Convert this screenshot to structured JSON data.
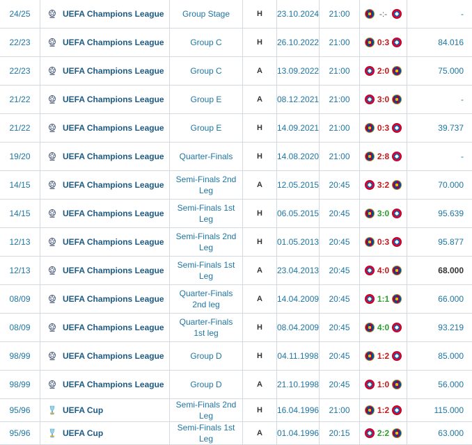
{
  "matches": [
    {
      "season": "24/25",
      "competition": "UEFA Champions League",
      "comp_icon": "ucl-icon",
      "round": "Group Stage",
      "venue": "H",
      "date": "23.10.2024",
      "time": "21:00",
      "home": "fcb",
      "away": "bay",
      "score": "-:-",
      "score_color": "grey",
      "attendance": "-",
      "att_bold": false
    },
    {
      "season": "22/23",
      "competition": "UEFA Champions League",
      "comp_icon": "ucl-icon",
      "round": "Group C",
      "venue": "H",
      "date": "26.10.2022",
      "time": "21:00",
      "home": "fcb",
      "away": "bay",
      "score": "0:3",
      "score_color": "red",
      "attendance": "84.016",
      "att_bold": false
    },
    {
      "season": "22/23",
      "competition": "UEFA Champions League",
      "comp_icon": "ucl-icon",
      "round": "Group C",
      "venue": "A",
      "date": "13.09.2022",
      "time": "21:00",
      "home": "bay",
      "away": "fcb",
      "score": "2:0",
      "score_color": "red",
      "attendance": "75.000",
      "att_bold": false
    },
    {
      "season": "21/22",
      "competition": "UEFA Champions League",
      "comp_icon": "ucl-icon",
      "round": "Group E",
      "venue": "A",
      "date": "08.12.2021",
      "time": "21:00",
      "home": "bay",
      "away": "fcb",
      "score": "3:0",
      "score_color": "red",
      "attendance": "-",
      "att_bold": false
    },
    {
      "season": "21/22",
      "competition": "UEFA Champions League",
      "comp_icon": "ucl-icon",
      "round": "Group E",
      "venue": "H",
      "date": "14.09.2021",
      "time": "21:00",
      "home": "fcb",
      "away": "bay",
      "score": "0:3",
      "score_color": "red",
      "attendance": "39.737",
      "att_bold": false
    },
    {
      "season": "19/20",
      "competition": "UEFA Champions League",
      "comp_icon": "ucl-icon",
      "round": "Quarter-Finals",
      "venue": "H",
      "date": "14.08.2020",
      "time": "21:00",
      "home": "fcb",
      "away": "bay",
      "score": "2:8",
      "score_color": "red",
      "attendance": "-",
      "att_bold": false
    },
    {
      "season": "14/15",
      "competition": "UEFA Champions League",
      "comp_icon": "ucl-icon",
      "round": "Semi-Finals 2nd Leg",
      "venue": "A",
      "date": "12.05.2015",
      "time": "20:45",
      "home": "bay",
      "away": "fcb",
      "score": "3:2",
      "score_color": "red",
      "attendance": "70.000",
      "att_bold": false
    },
    {
      "season": "14/15",
      "competition": "UEFA Champions League",
      "comp_icon": "ucl-icon",
      "round": "Semi-Finals 1st Leg",
      "venue": "H",
      "date": "06.05.2015",
      "time": "20:45",
      "home": "fcb",
      "away": "bay",
      "score": "3:0",
      "score_color": "green",
      "attendance": "95.639",
      "att_bold": false
    },
    {
      "season": "12/13",
      "competition": "UEFA Champions League",
      "comp_icon": "ucl-icon",
      "round": "Semi-Finals 2nd Leg",
      "venue": "H",
      "date": "01.05.2013",
      "time": "20:45",
      "home": "fcb",
      "away": "bay",
      "score": "0:3",
      "score_color": "red",
      "attendance": "95.877",
      "att_bold": false
    },
    {
      "season": "12/13",
      "competition": "UEFA Champions League",
      "comp_icon": "ucl-icon",
      "round": "Semi-Finals 1st Leg",
      "venue": "A",
      "date": "23.04.2013",
      "time": "20:45",
      "home": "bay",
      "away": "fcb",
      "score": "4:0",
      "score_color": "red",
      "attendance": "68.000",
      "att_bold": true
    },
    {
      "season": "08/09",
      "competition": "UEFA Champions League",
      "comp_icon": "ucl-icon",
      "round": "Quarter-Finals 2nd leg",
      "venue": "A",
      "date": "14.04.2009",
      "time": "20:45",
      "home": "bay",
      "away": "fcb",
      "score": "1:1",
      "score_color": "green",
      "attendance": "66.000",
      "att_bold": false
    },
    {
      "season": "08/09",
      "competition": "UEFA Champions League",
      "comp_icon": "ucl-icon",
      "round": "Quarter-Finals 1st leg",
      "venue": "H",
      "date": "08.04.2009",
      "time": "20:45",
      "home": "fcb",
      "away": "bay",
      "score": "4:0",
      "score_color": "green",
      "attendance": "93.219",
      "att_bold": false
    },
    {
      "season": "98/99",
      "competition": "UEFA Champions League",
      "comp_icon": "ucl-icon",
      "round": "Group D",
      "venue": "H",
      "date": "04.11.1998",
      "time": "20:45",
      "home": "fcb",
      "away": "bay",
      "score": "1:2",
      "score_color": "red",
      "attendance": "85.000",
      "att_bold": false
    },
    {
      "season": "98/99",
      "competition": "UEFA Champions League",
      "comp_icon": "ucl-icon",
      "round": "Group D",
      "venue": "A",
      "date": "21.10.1998",
      "time": "20:45",
      "home": "bay",
      "away": "fcb",
      "score": "1:0",
      "score_color": "red",
      "attendance": "56.000",
      "att_bold": false
    },
    {
      "season": "95/96",
      "competition": "UEFA Cup",
      "comp_icon": "uefa-cup-icon",
      "round": "Semi-Finals 2nd Leg",
      "venue": "H",
      "date": "16.04.1996",
      "time": "21:00",
      "home": "fcb",
      "away": "bay",
      "score": "1:2",
      "score_color": "red",
      "attendance": "115.000",
      "att_bold": false
    },
    {
      "season": "95/96",
      "competition": "UEFA Cup",
      "comp_icon": "uefa-cup-icon",
      "round": "Semi-Finals 1st Leg",
      "venue": "A",
      "date": "01.04.1996",
      "time": "20:15",
      "home": "bay",
      "away": "fcb",
      "score": "2:2",
      "score_color": "green",
      "attendance": "63.000",
      "att_bold": false
    }
  ]
}
